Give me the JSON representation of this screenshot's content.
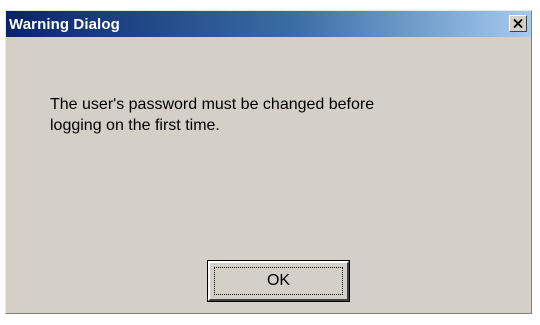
{
  "window": {
    "title": "Warning Dialog",
    "close_symbol": "×"
  },
  "message": {
    "line1": "The user's password must be changed before",
    "line2": "logging on the first time."
  },
  "buttons": {
    "ok_label": "OK"
  },
  "colors": {
    "titlebar_start": "#0a246a",
    "titlebar_end": "#a6caf0",
    "dialog_bg": "#d4d0c8"
  },
  "icons": {
    "close": "close-icon"
  }
}
